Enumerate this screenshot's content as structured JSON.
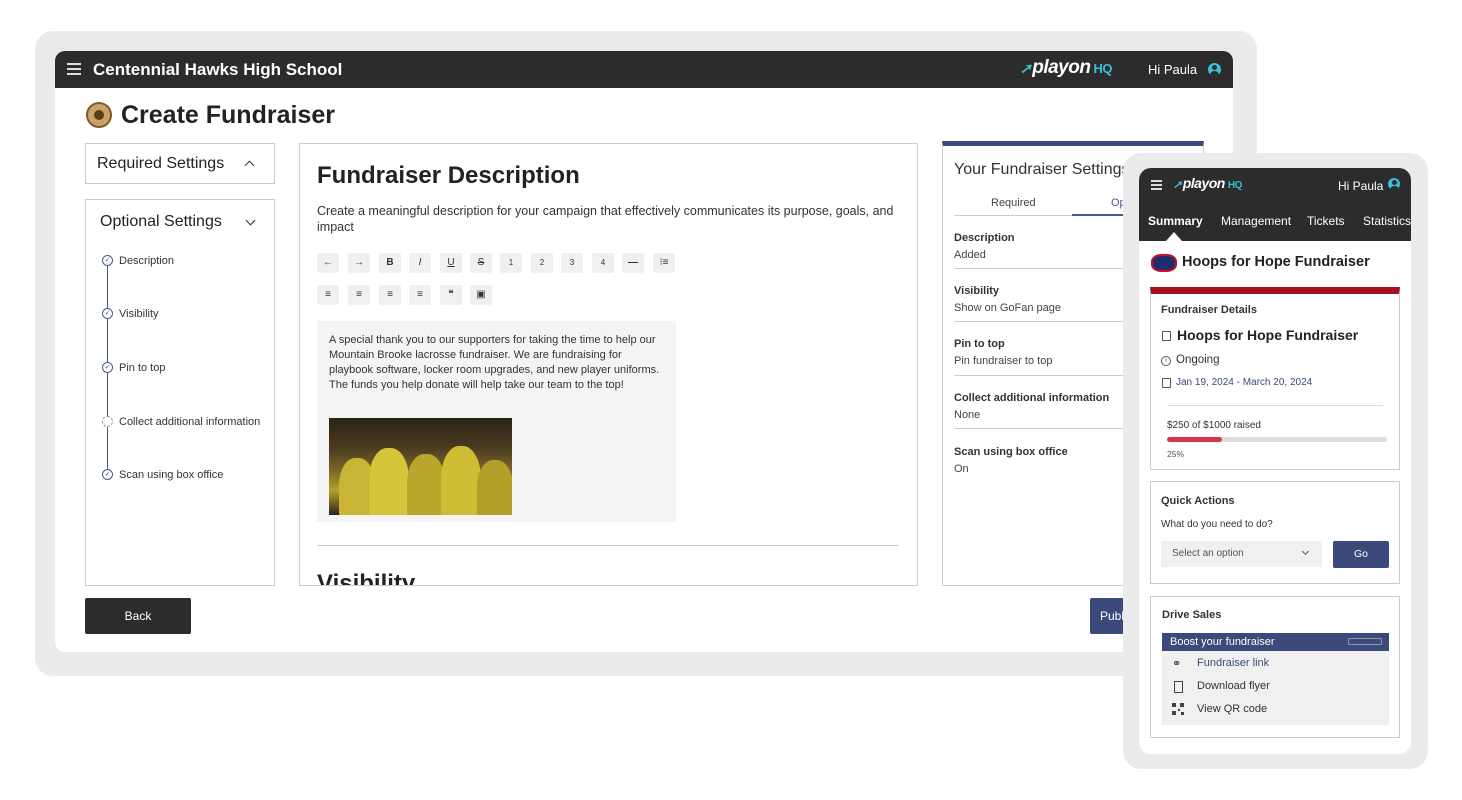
{
  "app": {
    "school_name": "Centennial Hawks High School",
    "brand_name": "playon",
    "brand_suffix": "HQ",
    "greeting": "Hi Paula"
  },
  "page": {
    "title": "Create Fundraiser"
  },
  "sidebar": {
    "required_label": "Required Settings",
    "optional_label": "Optional Settings",
    "steps": [
      {
        "label": "Description",
        "status": "complete"
      },
      {
        "label": "Visibility",
        "status": "complete"
      },
      {
        "label": "Pin to top",
        "status": "complete"
      },
      {
        "label": "Collect additional information",
        "status": "incomplete"
      },
      {
        "label": "Scan using box office",
        "status": "complete"
      }
    ]
  },
  "main": {
    "heading": "Fundraiser Description",
    "description": "Create a meaningful description for your campaign that effectively communicates its purpose, goals, and impact",
    "toolbar_row1": [
      "undo-icon",
      "redo-icon",
      "bold-icon",
      "italic-icon",
      "underline-icon",
      "strikethrough-icon",
      "heading-1-icon",
      "heading-2-icon",
      "heading-3-icon",
      "heading-4-icon",
      "horizontal-rule-icon",
      "bullet-list-icon"
    ],
    "toolbar_row2": [
      "numbered-list-icon",
      "align-left-icon",
      "align-center-icon",
      "align-right-icon",
      "quote-icon",
      "image-icon"
    ],
    "toolbar_glyphs": {
      "undo": "←",
      "redo": "→",
      "bold": "B",
      "italic": "I",
      "underline": "U",
      "strike": "S",
      "h1": "1",
      "h2": "2",
      "h3": "3",
      "h4": "4",
      "hr": "—",
      "bullets": "⁝≡",
      "numbered": "≡",
      "align_left": "≡",
      "align_center": "≡",
      "align_right": "≡",
      "quote": "❝",
      "image": "▣"
    },
    "editor_text": "A special thank you to our supporters for taking the time to help our Mountain Brooke lacrosse fundraiser. We are fundraising for playbook software, locker room upgrades, and new player uniforms. The funds you help donate will help take our team to the top!",
    "next_section_heading": "Visibility"
  },
  "settings_panel": {
    "title": "Your Fundraiser Settings",
    "tabs": [
      {
        "label": "Required",
        "active": false
      },
      {
        "label": "Option",
        "active": true
      }
    ],
    "items": [
      {
        "key": "Description",
        "value": "Added"
      },
      {
        "key": "Visibility",
        "value": "Show on GoFan page"
      },
      {
        "key": "Pin to top",
        "value": "Pin fundraiser to top"
      },
      {
        "key": "Collect additional information",
        "value": "None"
      },
      {
        "key": "Scan using box office",
        "value": "On"
      }
    ]
  },
  "footer": {
    "back_label": "Back",
    "publish_label": "Publish"
  },
  "mobile": {
    "greeting": "Hi Paula",
    "nav": [
      {
        "label": "Summary",
        "active": true
      },
      {
        "label": "Management",
        "active": false
      },
      {
        "label": "Tickets",
        "active": false
      },
      {
        "label": "Statistics",
        "active": false
      }
    ],
    "fundraiser_title": "Hoops for Hope Fundraiser",
    "details": {
      "heading": "Fundraiser Details",
      "name": "Hoops for Hope Fundraiser",
      "status": "Ongoing",
      "date_range": "Jan 19, 2024  - March 20, 2024",
      "raised_text": "$250 of $1000 raised",
      "progress_percent": 25,
      "progress_label": "25%"
    },
    "quick_actions": {
      "heading": "Quick Actions",
      "question": "What do you need to do?",
      "select_placeholder": "Select an option",
      "go_label": "Go"
    },
    "drive_sales": {
      "heading": "Drive Sales",
      "boost_label": "Boost your fundraiser",
      "items": [
        {
          "label": "Fundraiser link",
          "icon": "link-icon"
        },
        {
          "label": "Download flyer",
          "icon": "file-download-icon"
        },
        {
          "label": "View QR code",
          "icon": "qr-code-icon"
        }
      ]
    }
  },
  "colors": {
    "topbar": "#2c2c2c",
    "accent": "#3b4a7a",
    "brand_cyan": "#39c0d8",
    "progress": "#d4374b",
    "details_border": "#a6121f"
  }
}
